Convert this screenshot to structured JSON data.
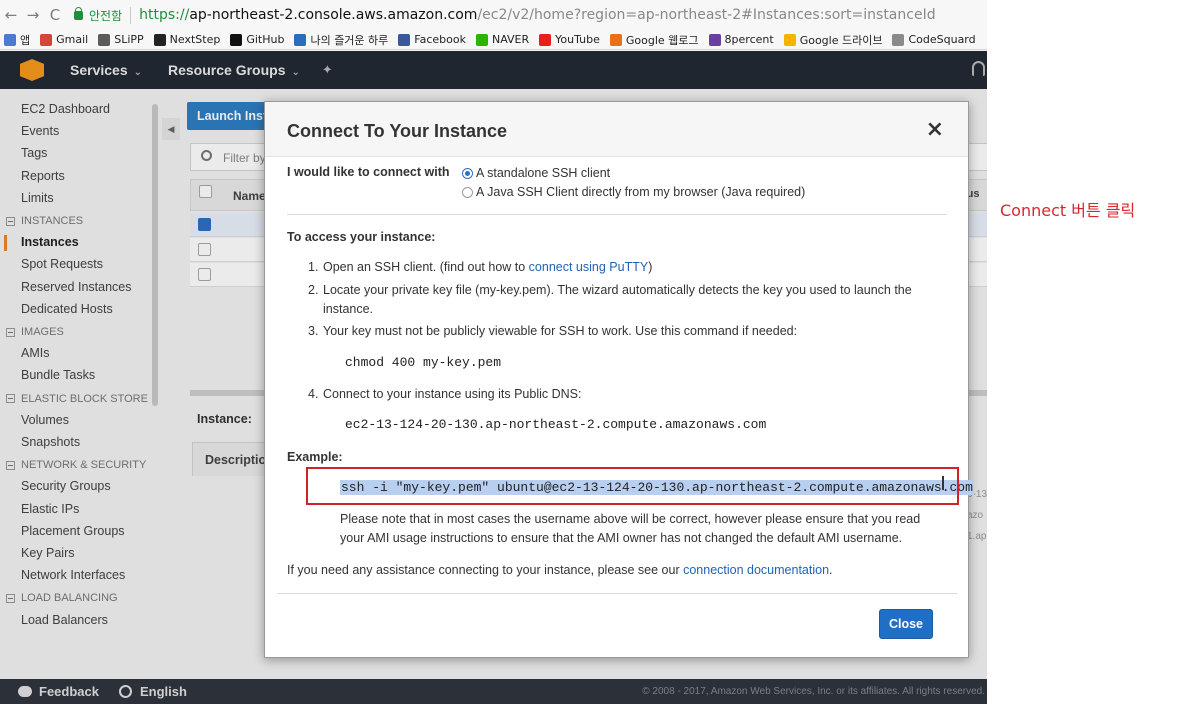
{
  "browser": {
    "nav": {
      "back": "←",
      "forward": "→",
      "reload": "C"
    },
    "secure_label": "안전함",
    "url_scheme": "https://",
    "url_host": "ap-northeast-2.console.aws.amazon.com",
    "url_path": "/ec2/v2/home?region=ap-northeast-2#Instances:sort=instanceId",
    "bookmarks": [
      {
        "label": "앱",
        "color": "#4a7bd1"
      },
      {
        "label": "Gmail",
        "color": "#d44638"
      },
      {
        "label": "SLiPP",
        "color": "#5b5b5b"
      },
      {
        "label": "NextStep",
        "color": "#222222"
      },
      {
        "label": "GitHub",
        "color": "#111111"
      },
      {
        "label": "나의 즐거운 하루",
        "color": "#2a6ebb"
      },
      {
        "label": "Facebook",
        "color": "#3b5998"
      },
      {
        "label": "NAVER",
        "color": "#2db400"
      },
      {
        "label": "YouTube",
        "color": "#e62117"
      },
      {
        "label": "Google 웹로그",
        "color": "#e8711a"
      },
      {
        "label": "8percent",
        "color": "#6b3fa0"
      },
      {
        "label": "Google 드라이브",
        "color": "#f4b400"
      },
      {
        "label": "CodeSquard",
        "color": "#8a8a8a"
      }
    ]
  },
  "aws_header": {
    "services": "Services",
    "resource_groups": "Resource Groups"
  },
  "sidebar": {
    "items": [
      {
        "label": "EC2 Dashboard",
        "type": "item"
      },
      {
        "label": "Events",
        "type": "item"
      },
      {
        "label": "Tags",
        "type": "item"
      },
      {
        "label": "Reports",
        "type": "item"
      },
      {
        "label": "Limits",
        "type": "item"
      },
      {
        "label": "INSTANCES",
        "type": "section"
      },
      {
        "label": "Instances",
        "type": "active"
      },
      {
        "label": "Spot Requests",
        "type": "item"
      },
      {
        "label": "Reserved Instances",
        "type": "item"
      },
      {
        "label": "Dedicated Hosts",
        "type": "item"
      },
      {
        "label": "IMAGES",
        "type": "section"
      },
      {
        "label": "AMIs",
        "type": "item"
      },
      {
        "label": "Bundle Tasks",
        "type": "item"
      },
      {
        "label": "ELASTIC BLOCK STORE",
        "type": "section"
      },
      {
        "label": "Volumes",
        "type": "item"
      },
      {
        "label": "Snapshots",
        "type": "item"
      },
      {
        "label": "NETWORK & SECURITY",
        "type": "section"
      },
      {
        "label": "Security Groups",
        "type": "item"
      },
      {
        "label": "Elastic IPs",
        "type": "item"
      },
      {
        "label": "Placement Groups",
        "type": "item"
      },
      {
        "label": "Key Pairs",
        "type": "item"
      },
      {
        "label": "Network Interfaces",
        "type": "item"
      },
      {
        "label": "LOAD BALANCING",
        "type": "section"
      },
      {
        "label": "Load Balancers",
        "type": "item"
      }
    ]
  },
  "main": {
    "launch_label": "Launch Inst",
    "filter_placeholder": "Filter by",
    "name_col": "Name",
    "status_col": "tus",
    "instance_label": "Instance:",
    "description_tab": "Descriptio",
    "right_fragments": [
      "0-13",
      "azo",
      "",
      "",
      "1.ap"
    ]
  },
  "modal": {
    "title": "Connect To Your Instance",
    "close_x": "×",
    "connect_label": "I would like to connect with",
    "options": [
      {
        "label": "A standalone SSH client",
        "selected": true
      },
      {
        "label": "A Java SSH Client directly from my browser (Java required)",
        "selected": false
      }
    ],
    "access_label": "To access your instance:",
    "step1_pre": "Open an SSH client. (find out how to ",
    "step1_link": "connect using PuTTY",
    "step1_post": ")",
    "step2": "Locate your private key file (my-key.pem). The wizard automatically detects the key you used to launch the instance.",
    "step3": "Your key must not be publicly viewable for SSH to work. Use this command if needed:",
    "chmod_cmd": "chmod 400 my-key.pem",
    "step4": "Connect to your instance using its Public DNS:",
    "public_dns": "ec2-13-124-20-130.ap-northeast-2.compute.amazonaws.com",
    "example_label": "Example:",
    "ssh_cmd": "ssh -i \"my-key.pem\" ubuntu@ec2-13-124-20-130.ap-northeast-2.compute.amazonaws.com",
    "note": "Please note that in most cases the username above will be correct, however please ensure that you read your AMI usage instructions to ensure that the AMI owner has not changed the default AMI username.",
    "help_pre": "If you need any assistance connecting to your instance, please see our ",
    "help_link": "connection documentation",
    "help_post": ".",
    "close_button": "Close"
  },
  "footer": {
    "feedback": "Feedback",
    "language": "English",
    "copyright": "© 2008 - 2017, Amazon Web Services, Inc. or its affiliates. All rights reserved."
  },
  "annotation": "Connect 버튼 클릭"
}
